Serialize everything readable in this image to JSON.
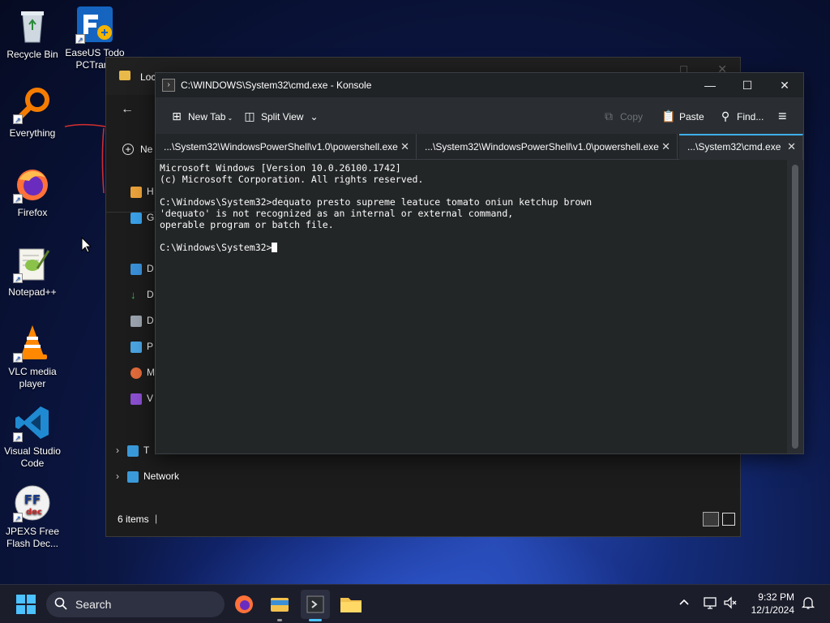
{
  "desktop": {
    "icons": [
      {
        "label": "Recycle Bin"
      },
      {
        "label": "EaseUS Todo PCTrans"
      },
      {
        "label": "Everything"
      },
      {
        "label": "Firefox"
      },
      {
        "label": "Notepad++"
      },
      {
        "label": "VLC media player"
      },
      {
        "label": "Visual Studio Code"
      },
      {
        "label": "JPEXS Free Flash Dec..."
      }
    ]
  },
  "explorer": {
    "title": "Loc",
    "new_label": "Ne",
    "nav_items": [
      "H",
      "G",
      "D",
      "D",
      "D",
      "P",
      "M",
      "V",
      "T"
    ],
    "network_label": "Network",
    "status_items": "6 items"
  },
  "konsole": {
    "title": "C:\\WINDOWS\\System32\\cmd.exe - Konsole",
    "toolbar": {
      "new_tab": "New Tab",
      "split_view": "Split View",
      "copy": "Copy",
      "paste": "Paste",
      "find": "Find..."
    },
    "tabs": [
      {
        "label": "...\\System32\\WindowsPowerShell\\v1.0\\powershell.exe"
      },
      {
        "label": "...\\System32\\WindowsPowerShell\\v1.0\\powershell.exe"
      },
      {
        "label": "...\\System32\\cmd.exe"
      }
    ],
    "terminal_lines": [
      "Microsoft Windows [Version 10.0.26100.1742]",
      "(c) Microsoft Corporation. All rights reserved.",
      "",
      "C:\\Windows\\System32>dequato presto supreme leatuce tomato oniun ketchup brown",
      "'dequato' is not recognized as an internal or external command,",
      "operable program or batch file.",
      ""
    ],
    "prompt": "C:\\Windows\\System32>"
  },
  "taskbar": {
    "search_placeholder": "Search",
    "time": "9:32 PM",
    "date": "12/1/2024"
  },
  "colors": {
    "konsole_accent": "#3daee9",
    "terminal_bg": "#232627"
  }
}
